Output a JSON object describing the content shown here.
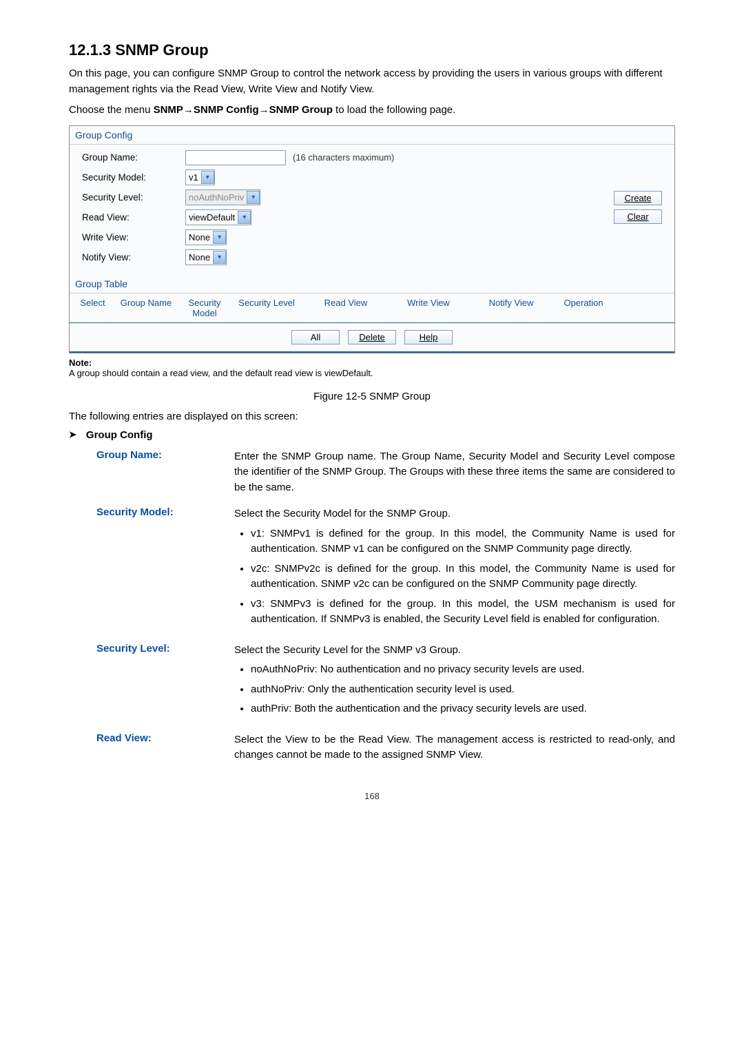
{
  "title": "12.1.3  SNMP Group",
  "intro1": "On this page, you can configure SNMP Group to control the network access by providing the users in various groups with different management rights via the Read View, Write View and Notify View.",
  "intro2_prefix": "Choose the menu ",
  "intro2_bold": "SNMP→SNMP Config→SNMP Group",
  "intro2_suffix": " to load the following page.",
  "panel": {
    "config_head": "Group Config",
    "group_name_label": "Group Name:",
    "group_name_hint": "(16 characters maximum)",
    "security_model_label": "Security Model:",
    "security_model_value": "v1",
    "security_level_label": "Security Level:",
    "security_level_value": "noAuthNoPriv",
    "read_view_label": "Read View:",
    "read_view_value": "viewDefault",
    "write_view_label": "Write View:",
    "write_view_value": "None",
    "notify_view_label": "Notify View:",
    "notify_view_value": "None",
    "create_btn": "Create",
    "clear_btn": "Clear",
    "table_head": "Group Table",
    "cols": {
      "c1": "Select",
      "c2": "Group Name",
      "c3": "Security Model",
      "c4": "Security Level",
      "c5": "Read View",
      "c6": "Write View",
      "c7": "Notify View",
      "c8": "Operation"
    },
    "all_btn": "All",
    "delete_btn": "Delete",
    "help_btn": "Help"
  },
  "note_label": "Note:",
  "note_text": "A group should contain a read view, and the default read view is viewDefault.",
  "figure_caption": "Figure 12-5 SNMP Group",
  "displayed_line": "The following entries are displayed on this screen:",
  "section_head": "Group Config",
  "defs": {
    "group_name_term": "Group Name:",
    "group_name_def": "Enter the SNMP Group name. The Group Name, Security Model and Security Level compose the identifier of the SNMP Group. The Groups with these three items the same are considered to be the same.",
    "security_model_term": "Security Model:",
    "security_model_def_intro": "Select the Security Model for the SNMP Group.",
    "security_model_li1": "v1: SNMPv1 is defined for the group. In this model, the Community Name is used for authentication. SNMP v1 can be configured on the SNMP Community page directly.",
    "security_model_li2": "v2c: SNMPv2c is defined for the group. In this model, the Community Name is used for authentication. SNMP v2c can be configured on the SNMP Community page directly.",
    "security_model_li3": "v3: SNMPv3 is defined for the group. In this model, the USM mechanism is used for authentication. If SNMPv3 is enabled, the Security Level field is enabled for configuration.",
    "security_level_term": "Security Level:",
    "security_level_def_intro": "Select the Security Level for the SNMP v3 Group.",
    "security_level_li1": "noAuthNoPriv: No authentication and no privacy security levels are used.",
    "security_level_li2": "authNoPriv: Only the authentication security level is used.",
    "security_level_li3": "authPriv: Both the authentication and the privacy security levels are used.",
    "read_view_term": "Read View:",
    "read_view_def": "Select the View to be the Read View. The management access is restricted to read-only, and changes cannot be made to the assigned SNMP View."
  },
  "page_number": "168"
}
